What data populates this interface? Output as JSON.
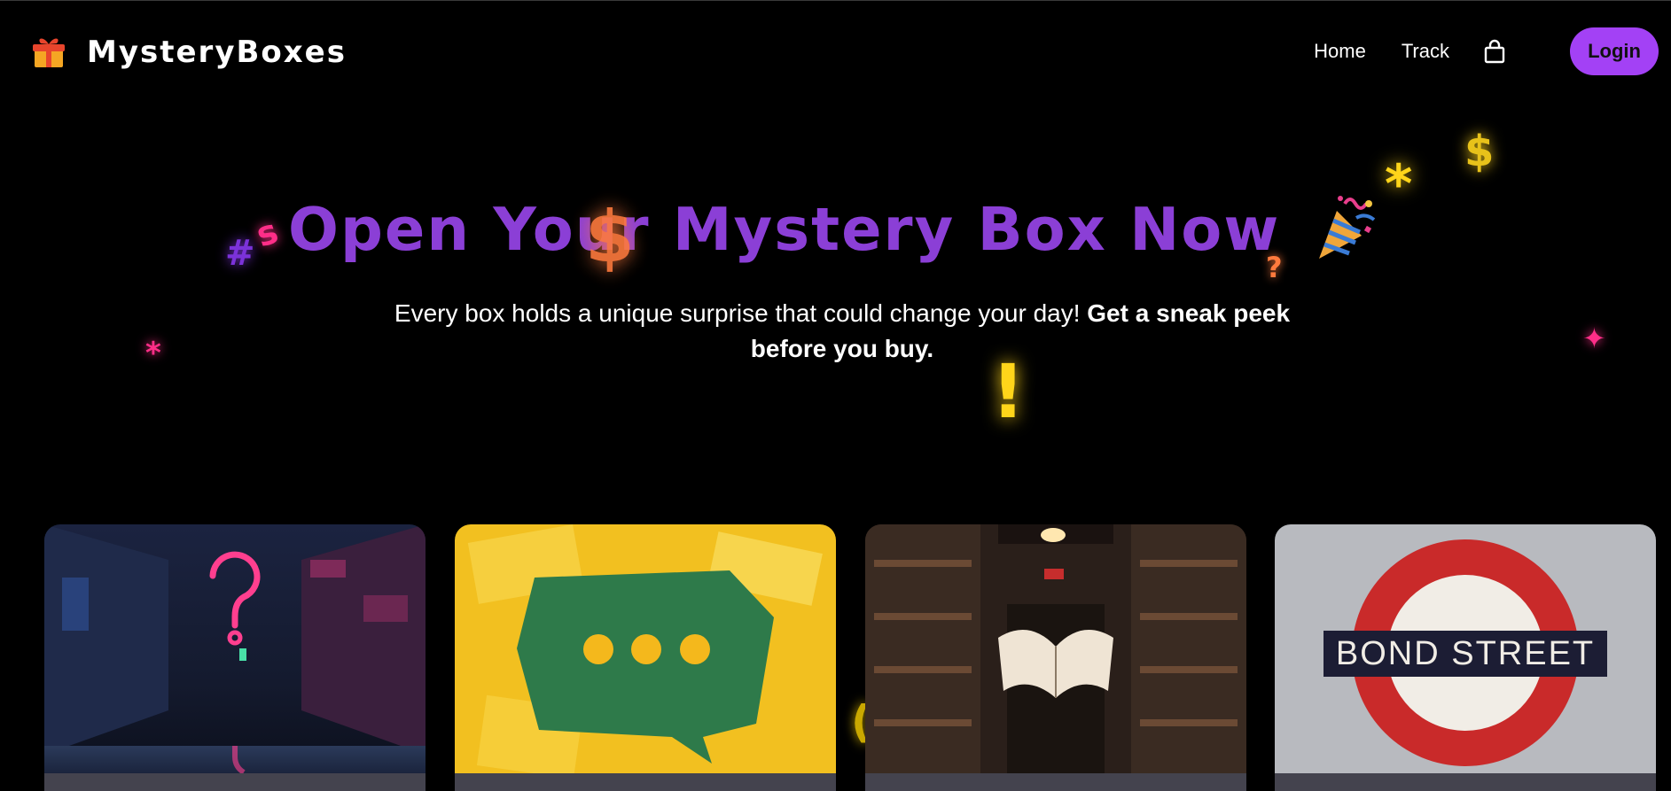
{
  "header": {
    "logo_icon": "gift-icon",
    "brand_name": "MysteryBoxes",
    "nav": {
      "home": "Home",
      "track": "Track",
      "cart_icon": "shopping-bag-icon",
      "login": "Login"
    }
  },
  "hero": {
    "title": "Open Your Mystery Box Now",
    "title_icon": "party-popper-icon",
    "subtitle_regular": "Every box holds a unique surprise that could change your day!",
    "subtitle_bold": "Get a sneak peek before you buy."
  },
  "cards": [
    {
      "image": "neon-question-mark-alley"
    },
    {
      "image": "speech-bubble-ellipsis"
    },
    {
      "image": "floating-book-library"
    },
    {
      "image": "bond-street-sign",
      "sign_text": "BOND STREET"
    }
  ],
  "colors": {
    "accent": "#a341f5",
    "title": "#8b3fd6",
    "background": "#000000",
    "glyph_pink": "#ff2e88",
    "glyph_yellow": "#ffd51a",
    "glyph_orange": "#ff7a3d"
  }
}
